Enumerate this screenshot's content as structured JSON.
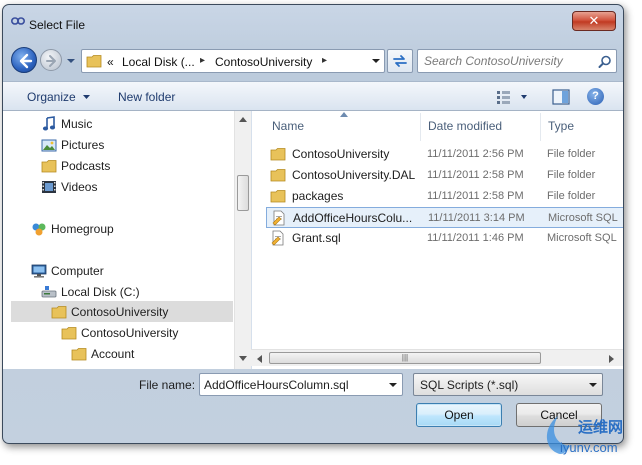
{
  "window": {
    "title": "Select File",
    "close_label": "✕"
  },
  "address": {
    "prefix": "«",
    "crumbs": [
      "Local Disk (...",
      "ContosoUniversity"
    ],
    "separator": "▸"
  },
  "search": {
    "placeholder": "Search ContosoUniversity"
  },
  "toolbar": {
    "organize_label": "Organize",
    "new_folder_label": "New folder",
    "help_label": "?"
  },
  "nav_pane": {
    "items": [
      {
        "label": "Music",
        "icon": "music-icon"
      },
      {
        "label": "Pictures",
        "icon": "pictures-icon"
      },
      {
        "label": "Podcasts",
        "icon": "folder-icon"
      },
      {
        "label": "Videos",
        "icon": "videos-icon"
      },
      {
        "label": "Homegroup",
        "icon": "homegroup-icon"
      },
      {
        "label": "Computer",
        "icon": "computer-icon"
      },
      {
        "label": "Local Disk (C:)",
        "icon": "drive-icon"
      },
      {
        "label": "ContosoUniversity",
        "icon": "folder-icon"
      },
      {
        "label": "ContosoUniversity",
        "icon": "folder-icon"
      },
      {
        "label": "Account",
        "icon": "folder-icon"
      }
    ],
    "selected_item": "ContosoUniversity"
  },
  "file_list": {
    "columns": [
      "Name",
      "Date modified",
      "Type"
    ],
    "rows": [
      {
        "name": "ContosoUniversity",
        "date": "11/11/2011 2:56 PM",
        "type": "File folder",
        "icon": "folder-icon"
      },
      {
        "name": "ContosoUniversity.DAL",
        "date": "11/11/2011 2:58 PM",
        "type": "File folder",
        "icon": "folder-icon"
      },
      {
        "name": "packages",
        "date": "11/11/2011 2:58 PM",
        "type": "File folder",
        "icon": "folder-icon"
      },
      {
        "name": "AddOfficeHoursColu...",
        "date": "11/11/2011 3:14 PM",
        "type": "Microsoft SQL",
        "icon": "sql-file-icon"
      },
      {
        "name": "Grant.sql",
        "date": "11/11/2011 1:46 PM",
        "type": "Microsoft SQL",
        "icon": "sql-file-icon"
      }
    ],
    "selected_row": "AddOfficeHoursColu...",
    "hscroll_grip": "|||"
  },
  "footer": {
    "file_name_label": "File name:",
    "file_name_value": "AddOfficeHoursColumn.sql",
    "file_type_value": "SQL Scripts (*.sql)",
    "open_label": "Open",
    "cancel_label": "Cancel"
  },
  "watermark": {
    "text_cn": "运维网",
    "text_url": "iyunv.com"
  },
  "colors": {
    "selection_bg": "#e6f0fa",
    "selection_border": "#84acdd",
    "folder": "#e8c25a",
    "close_red": "#c13a22",
    "link_blue": "#1f3b6e"
  }
}
